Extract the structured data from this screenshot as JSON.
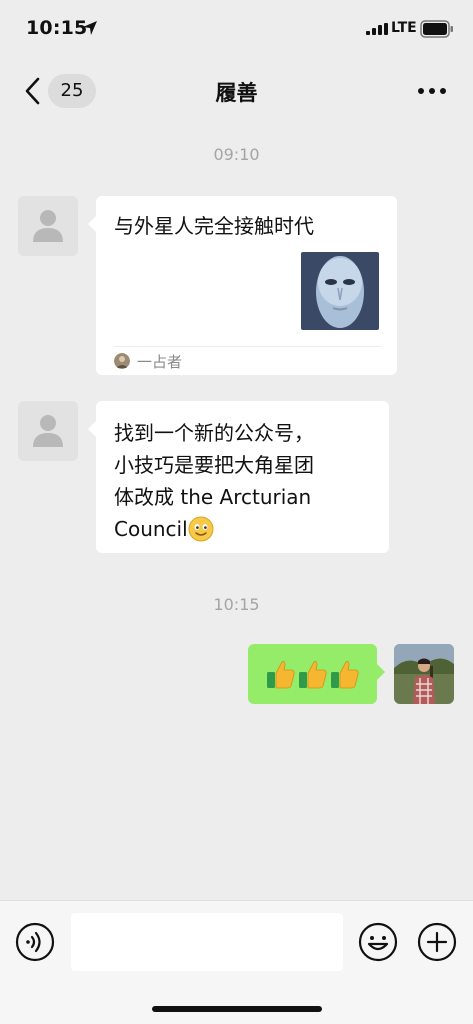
{
  "status_bar": {
    "time": "10:15",
    "network": "LTE",
    "icons": [
      "location-arrow-icon",
      "signal-icon",
      "battery-icon"
    ]
  },
  "nav": {
    "back_icon": "chevron-left-icon",
    "unread_count": "25",
    "title": "履善",
    "more_icon": "ellipsis-icon"
  },
  "messages": {
    "time1": "09:10",
    "card": {
      "title": "与外星人完全接触时代",
      "source": "一占者",
      "thumb": "alien-face-image"
    },
    "text_lines": [
      "找到一个新的公众号，",
      "小技巧是要把大角星团",
      "体改成 the Arcturian",
      "Council"
    ],
    "text_emoji": "smiley-emoji",
    "time2": "10:15",
    "sent_emoji": [
      "thumbs-up-emoji",
      "thumbs-up-emoji",
      "thumbs-up-emoji"
    ]
  },
  "input_bar": {
    "voice_icon": "voice-icon",
    "input_value": "",
    "emoji_icon": "emoji-icon",
    "plus_icon": "plus-icon"
  },
  "colors": {
    "background": "#ededed",
    "bubble_sent": "#95ec69",
    "bubble_received": "#ffffff"
  }
}
